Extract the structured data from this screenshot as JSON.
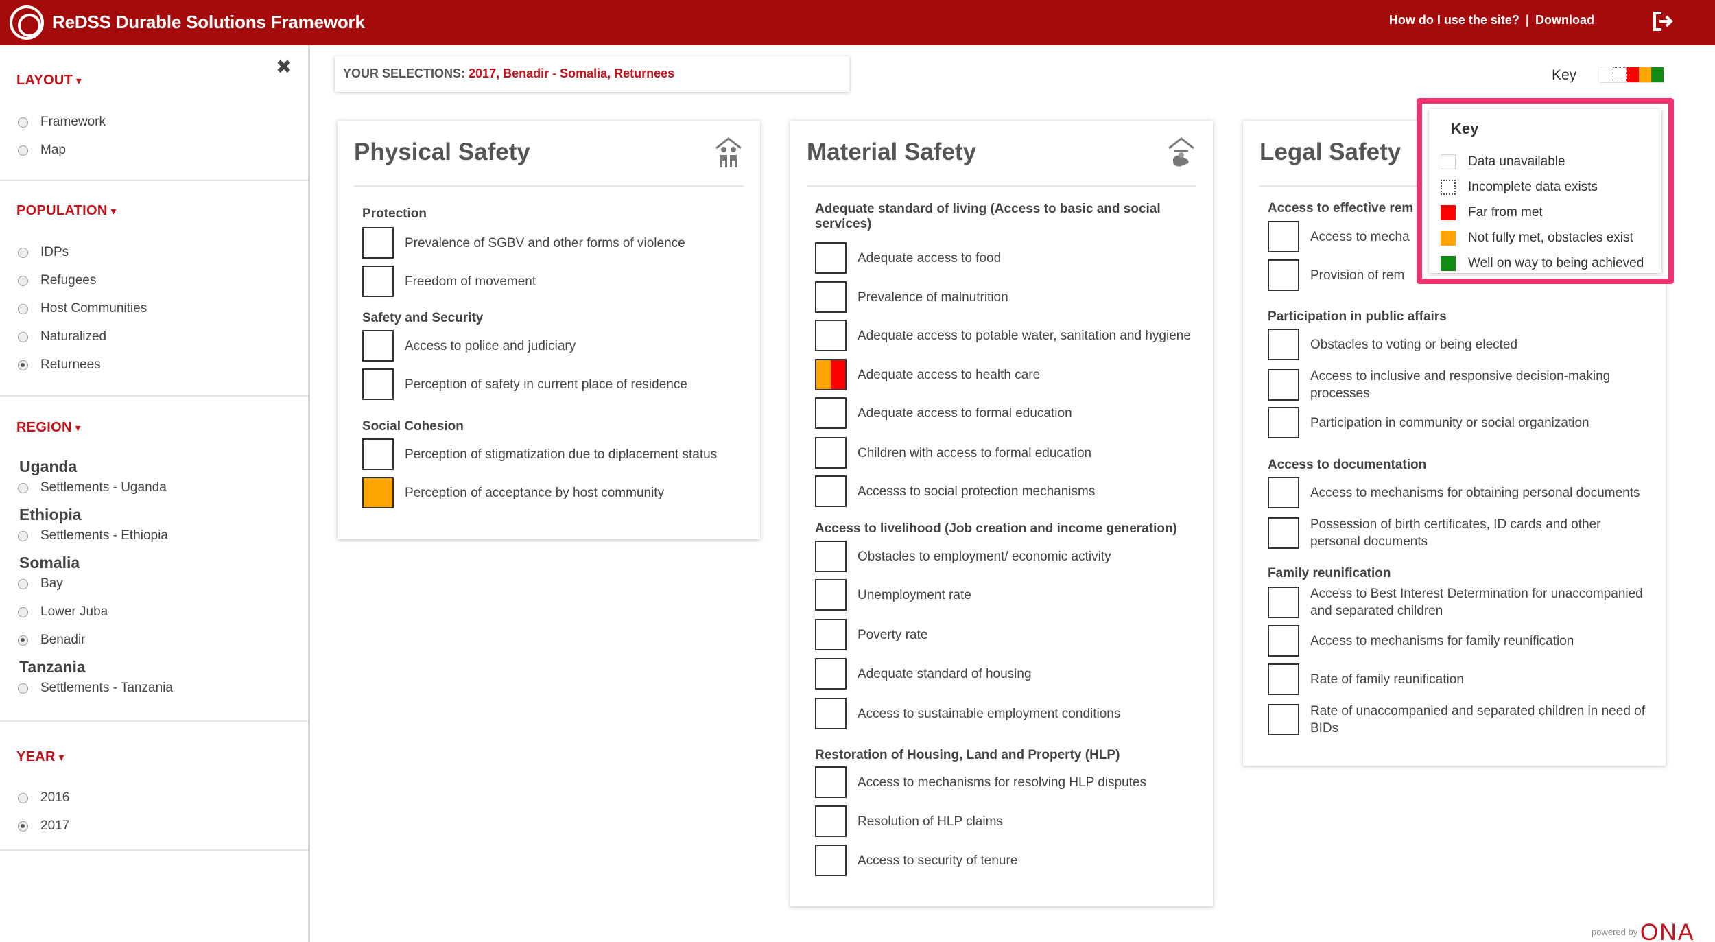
{
  "header": {
    "title": "ReDSS Durable Solutions Framework",
    "help_link": "How do I use the site?",
    "separator": "|",
    "download_link": "Download"
  },
  "sidebar": {
    "layout": {
      "heading": "LAYOUT",
      "options": [
        {
          "label": "Framework",
          "selected": false
        },
        {
          "label": "Map",
          "selected": false
        }
      ]
    },
    "population": {
      "heading": "POPULATION",
      "options": [
        {
          "label": "IDPs",
          "selected": false
        },
        {
          "label": "Refugees",
          "selected": false
        },
        {
          "label": "Host Communities",
          "selected": false
        },
        {
          "label": "Naturalized",
          "selected": false
        },
        {
          "label": "Returnees",
          "selected": true
        }
      ]
    },
    "region": {
      "heading": "REGION",
      "countries": [
        {
          "name": "Uganda",
          "options": [
            {
              "label": "Settlements - Uganda",
              "selected": false
            }
          ]
        },
        {
          "name": "Ethiopia",
          "options": [
            {
              "label": "Settlements - Ethiopia",
              "selected": false
            }
          ]
        },
        {
          "name": "Somalia",
          "options": [
            {
              "label": "Bay",
              "selected": false
            },
            {
              "label": "Lower Juba",
              "selected": false
            },
            {
              "label": "Benadir",
              "selected": true
            }
          ]
        },
        {
          "name": "Tanzania",
          "options": [
            {
              "label": "Settlements - Tanzania",
              "selected": false
            }
          ]
        }
      ]
    },
    "year": {
      "heading": "YEAR",
      "options": [
        {
          "label": "2016",
          "selected": false
        },
        {
          "label": "2017",
          "selected": true
        }
      ]
    }
  },
  "selections": {
    "label": "YOUR SELECTIONS:",
    "value": "2017, Benadir - Somalia, Returnees"
  },
  "key": {
    "label": "Key",
    "title": "Key",
    "strip_colors": [
      "#ffffff",
      "#ffffff",
      "#ff0000",
      "#ffa500",
      "#138a13"
    ],
    "items": [
      {
        "label": "Data unavailable",
        "color": "#ffffff",
        "style": "solid"
      },
      {
        "label": "Incomplete data exists",
        "color": "#ffffff",
        "style": "dotted"
      },
      {
        "label": "Far from met",
        "color": "#ff0000",
        "style": "solid"
      },
      {
        "label": "Not fully met, obstacles exist",
        "color": "#ffa500",
        "style": "solid"
      },
      {
        "label": "Well on way to being achieved",
        "color": "#138a13",
        "style": "solid"
      }
    ]
  },
  "cards": [
    {
      "title": "Physical Safety",
      "icon": "family-icon",
      "groups": [
        {
          "heading": "Protection",
          "indicators": [
            {
              "label": "Prevalence of SGBV and other forms of violence",
              "status": []
            },
            {
              "label": "Freedom of movement",
              "status": []
            }
          ]
        },
        {
          "heading": "Safety and Security",
          "indicators": [
            {
              "label": "Access to police and judiciary",
              "status": []
            },
            {
              "label": "Perception of safety in current place of residence",
              "status": []
            }
          ]
        },
        {
          "heading": "Social Cohesion",
          "indicators": [
            {
              "label": "Perception of stigmatization due to diplacement status",
              "status": []
            },
            {
              "label": "Perception of acceptance by host community",
              "status": [
                "#ffa500"
              ]
            }
          ]
        }
      ]
    },
    {
      "title": "Material Safety",
      "icon": "hand-house-icon",
      "groups": [
        {
          "heading": "Adequate standard of living (Access to basic and social services)",
          "indicators": [
            {
              "label": "Adequate access to food",
              "status": []
            },
            {
              "label": "Prevalence of malnutrition",
              "status": []
            },
            {
              "label": "Adequate access to potable water, sanitation and hygiene",
              "status": []
            },
            {
              "label": "Adequate access to health care",
              "status": [
                "#ffa500",
                "#ff0000"
              ]
            },
            {
              "label": "Adequate access to formal education",
              "status": []
            },
            {
              "label": "Children with access to formal education",
              "status": []
            },
            {
              "label": "Accesss to social protection mechanisms",
              "status": []
            }
          ]
        },
        {
          "heading": "Access to livelihood (Job creation and income generation)",
          "indicators": [
            {
              "label": "Obstacles to employment/ economic activity",
              "status": []
            },
            {
              "label": "Unemployment rate",
              "status": []
            },
            {
              "label": "Poverty rate",
              "status": []
            },
            {
              "label": "Adequate standard of housing",
              "status": []
            },
            {
              "label": "Access to sustainable employment conditions",
              "status": []
            }
          ]
        },
        {
          "heading": "Restoration of Housing, Land and Property (HLP)",
          "indicators": [
            {
              "label": "Access to mechanisms for resolving HLP disputes",
              "status": []
            },
            {
              "label": "Resolution of HLP claims",
              "status": []
            },
            {
              "label": "Access to security of tenure",
              "status": []
            }
          ]
        }
      ]
    },
    {
      "title": "Legal Safety",
      "icon": "",
      "groups": [
        {
          "heading": "Access to effective rem",
          "indicators": [
            {
              "label": "Access to mecha",
              "status": []
            },
            {
              "label": "Provision of rem",
              "status": []
            }
          ]
        },
        {
          "heading": "Participation in public affairs",
          "indicators": [
            {
              "label": "Obstacles to voting or being elected",
              "status": []
            },
            {
              "label": "Access to inclusive and responsive decision-making processes",
              "status": []
            },
            {
              "label": "Participation in community or social organization",
              "status": []
            }
          ]
        },
        {
          "heading": "Access to documentation",
          "indicators": [
            {
              "label": "Access to mechanisms for obtaining personal documents",
              "status": []
            },
            {
              "label": "Possession of birth certificates, ID cards and other personal documents",
              "status": []
            }
          ]
        },
        {
          "heading": "Family reunification",
          "indicators": [
            {
              "label": "Access to Best Interest Determination for unaccompanied and separated children",
              "status": []
            },
            {
              "label": "Access to mechanisms for family reunification",
              "status": []
            },
            {
              "label": "Rate of family reunification",
              "status": []
            },
            {
              "label": "Rate of unaccompanied and separated children in need of BIDs",
              "status": []
            }
          ]
        }
      ]
    }
  ],
  "footer": {
    "powered_by": "powered by",
    "brand": "ONA"
  }
}
